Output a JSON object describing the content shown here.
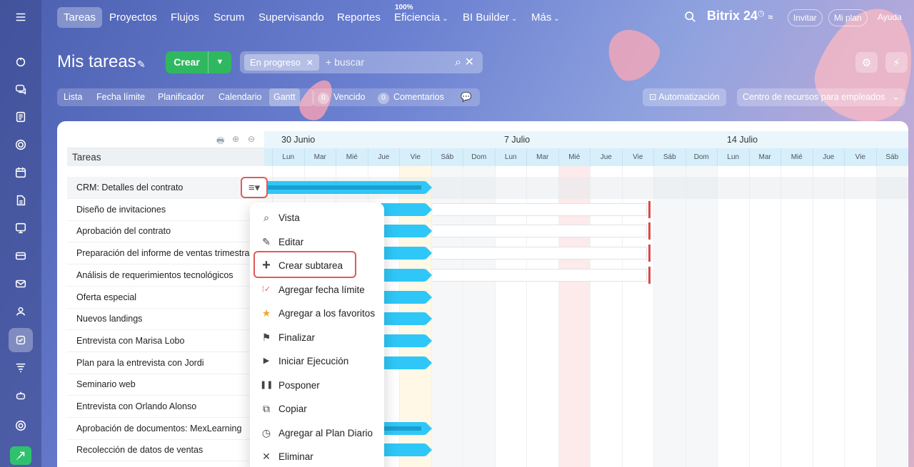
{
  "nav": {
    "items": [
      "Tareas",
      "Proyectos",
      "Flujos",
      "Scrum",
      "Supervisando",
      "Reportes",
      "Eficiencia",
      "BI Builder",
      "Más"
    ],
    "efficiency_badge": "100%",
    "brand": "Bitrix 24",
    "invite": "Invitar",
    "my_plan": "Mi plan",
    "help": "Ayuda"
  },
  "header": {
    "title": "Mis tareas",
    "create_label": "Crear",
    "filter_chip": "En progreso",
    "search_placeholder": "+ buscar"
  },
  "views": {
    "tabs": [
      "Lista",
      "Fecha límite",
      "Planificador",
      "Calendario",
      "Gantt"
    ],
    "active": "Gantt",
    "overdue_count": "0",
    "overdue_label": "Vencido",
    "comments_count": "0",
    "comments_label": "Comentarios",
    "automation": "Automatización",
    "resource_center": "Centro de recursos para empleados"
  },
  "tree": {
    "header": "Tareas",
    "rows": [
      "CRM: Detalles del contrato",
      "Diseño de invitaciones",
      "Aprobación del contrato",
      "Preparación del informe de ventas trimestral",
      "Análisis de requerimientos tecnológicos",
      "Oferta especial",
      "Nuevos landings",
      "Entrevista con Marisa Lobo",
      "Plan para la entrevista con Jordi",
      "Seminario web",
      "Entrevista con Orlando Alonso",
      "Aprobación de documentos: MexLearning",
      "Recolección de datos de ventas"
    ]
  },
  "gantt": {
    "weeks": [
      "30 Junio",
      "7 Julio",
      "14 Julio"
    ],
    "days": [
      "Lun",
      "Mar",
      "Mié",
      "Jue",
      "Vie",
      "Sáb",
      "Dom",
      "Lun",
      "Mar",
      "Mié",
      "Jue",
      "Vie",
      "Sáb",
      "Dom",
      "Lun",
      "Mar",
      "Mié",
      "Jue",
      "Vie",
      "Sáb"
    ]
  },
  "context_menu": {
    "items": [
      {
        "label": "Vista",
        "icon": "search-icon"
      },
      {
        "label": "Editar",
        "icon": "pencil-icon"
      },
      {
        "label": "Crear subtarea",
        "icon": "plus-icon"
      },
      {
        "label": "Agregar fecha límite",
        "icon": "deadline-icon"
      },
      {
        "label": "Agregar a los favoritos",
        "icon": "star-icon"
      },
      {
        "label": "Finalizar",
        "icon": "flag-icon"
      },
      {
        "label": "Iniciar Ejecución",
        "icon": "play-icon"
      },
      {
        "label": "Posponer",
        "icon": "pause-icon"
      },
      {
        "label": "Copiar",
        "icon": "copy-icon"
      },
      {
        "label": "Agregar al Plan Diario",
        "icon": "clock-icon"
      },
      {
        "label": "Eliminar",
        "icon": "close-icon"
      }
    ]
  },
  "colors": {
    "accent_green": "#2fb860",
    "bar_blue": "#2fc7f7",
    "highlight_red": "#e05a5a"
  }
}
